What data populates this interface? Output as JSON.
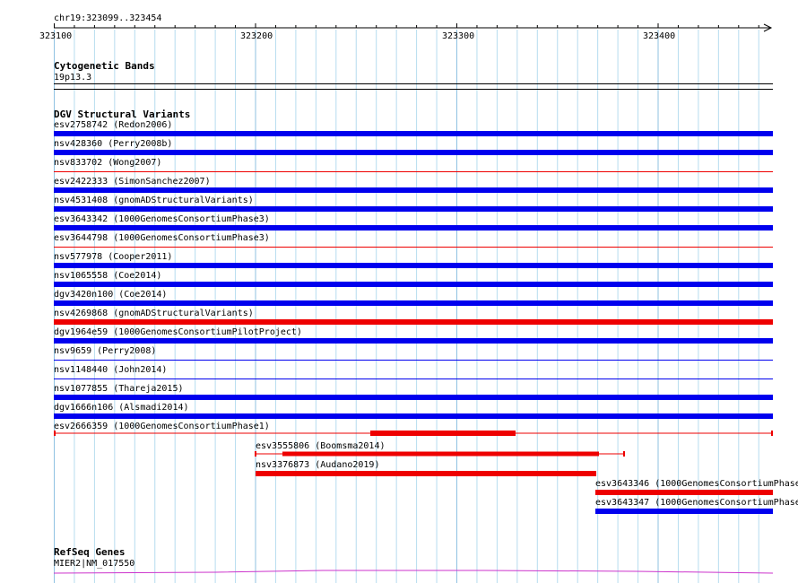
{
  "ruler": {
    "location": "chr19:323099..323454",
    "ticks": [
      "323100",
      "323200",
      "323300",
      "323400"
    ]
  },
  "tracks": {
    "cyto": {
      "title": "Cytogenetic Bands",
      "band": "19p13.3"
    },
    "dgv": {
      "title": "DGV Structural Variants",
      "variants": [
        {
          "label": "esv2758742 (Redon2006)",
          "color": "#0000ee",
          "style": "thick"
        },
        {
          "label": "nsv428360 (Perry2008b)",
          "color": "#0000ee",
          "style": "thick"
        },
        {
          "label": "nsv833702 (Wong2007)",
          "color": "#ee0000",
          "style": "thin"
        },
        {
          "label": "esv2422333 (SimonSanchez2007)",
          "color": "#0000ee",
          "style": "thick"
        },
        {
          "label": "nsv4531408 (gnomADStructuralVariants)",
          "color": "#0000ee",
          "style": "thick"
        },
        {
          "label": "esv3643342 (1000GenomesConsortiumPhase3)",
          "color": "#0000ee",
          "style": "thick"
        },
        {
          "label": "esv3644798 (1000GenomesConsortiumPhase3)",
          "color": "#ee0000",
          "style": "thin"
        },
        {
          "label": "nsv577978 (Cooper2011)",
          "color": "#0000ee",
          "style": "thick"
        },
        {
          "label": "nsv1065558 (Coe2014)",
          "color": "#0000ee",
          "style": "thick"
        },
        {
          "label": "dgv3420n100 (Coe2014)",
          "color": "#0000ee",
          "style": "thick"
        },
        {
          "label": "nsv4269868 (gnomADStructuralVariants)",
          "color": "#ee0000",
          "style": "thick"
        },
        {
          "label": "dgv1964e59 (1000GenomesConsortiumPilotProject)",
          "color": "#0000ee",
          "style": "thick"
        },
        {
          "label": "nsv9659 (Perry2008)",
          "color": "#0000ee",
          "style": "thin"
        },
        {
          "label": "nsv1148440 (John2014)",
          "color": "#0000ee",
          "style": "thin"
        },
        {
          "label": "nsv1077855 (Thareja2015)",
          "color": "#0000ee",
          "style": "thick"
        },
        {
          "label": "dgv1666n106 (Alsmadi2014)",
          "color": "#0000ee",
          "style": "thick"
        },
        {
          "label": "esv2666359 (1000GenomesConsortiumPhase1)",
          "color": "#ee0000",
          "style": "complex"
        }
      ],
      "partial": [
        {
          "label": "esv3555806 (Boomsma2014)",
          "color": "#ee0000"
        },
        {
          "label": "nsv3376873 (Audano2019)",
          "color": "#ee0000"
        },
        {
          "label": "esv3643346 (1000GenomesConsortiumPhase",
          "color": "#ee0000"
        },
        {
          "label": "esv3643347 (1000GenomesConsortiumPhase",
          "color": "#0000ee"
        }
      ]
    },
    "refseq": {
      "title": "RefSeq Genes",
      "gene": "MIER2|NM_017550",
      "color": "#cc33cc"
    }
  },
  "colors": {
    "grid": "#a8d0e8",
    "blue": "#0000ee",
    "red": "#ee0000"
  }
}
